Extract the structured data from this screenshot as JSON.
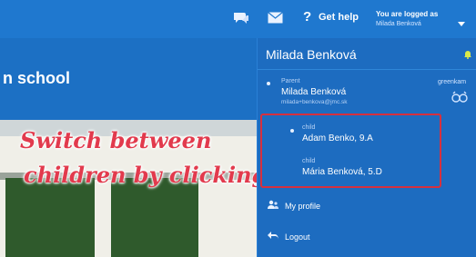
{
  "header": {
    "help_label": "Get help",
    "help_symbol": "?",
    "logged_as_label": "You are logged as",
    "logged_user": "Milada Benková",
    "icons": [
      "chat-icon",
      "mail-icon",
      "chevron-down-icon"
    ]
  },
  "main": {
    "school_title": "n school"
  },
  "callout": {
    "line1": "Switch between",
    "line2": "children by clicking",
    "color": "#e23a4d"
  },
  "panel": {
    "user_name": "Milada Benková",
    "parent": {
      "role": "Parent",
      "name": "Milada Benková",
      "email": "milada+benkova@jmc.sk"
    },
    "brand": "greenkam",
    "children": [
      {
        "role": "child",
        "name": "Adam Benko, 9.A"
      },
      {
        "role": "child",
        "name": "Mária Benková, 5.D"
      }
    ],
    "menu": {
      "profile_label": "My profile",
      "logout_label": "Logout"
    },
    "highlight_color": "#d7303e"
  },
  "colors": {
    "header_bg": "#1f78cf",
    "panel_bg": "#1d6cc0"
  }
}
